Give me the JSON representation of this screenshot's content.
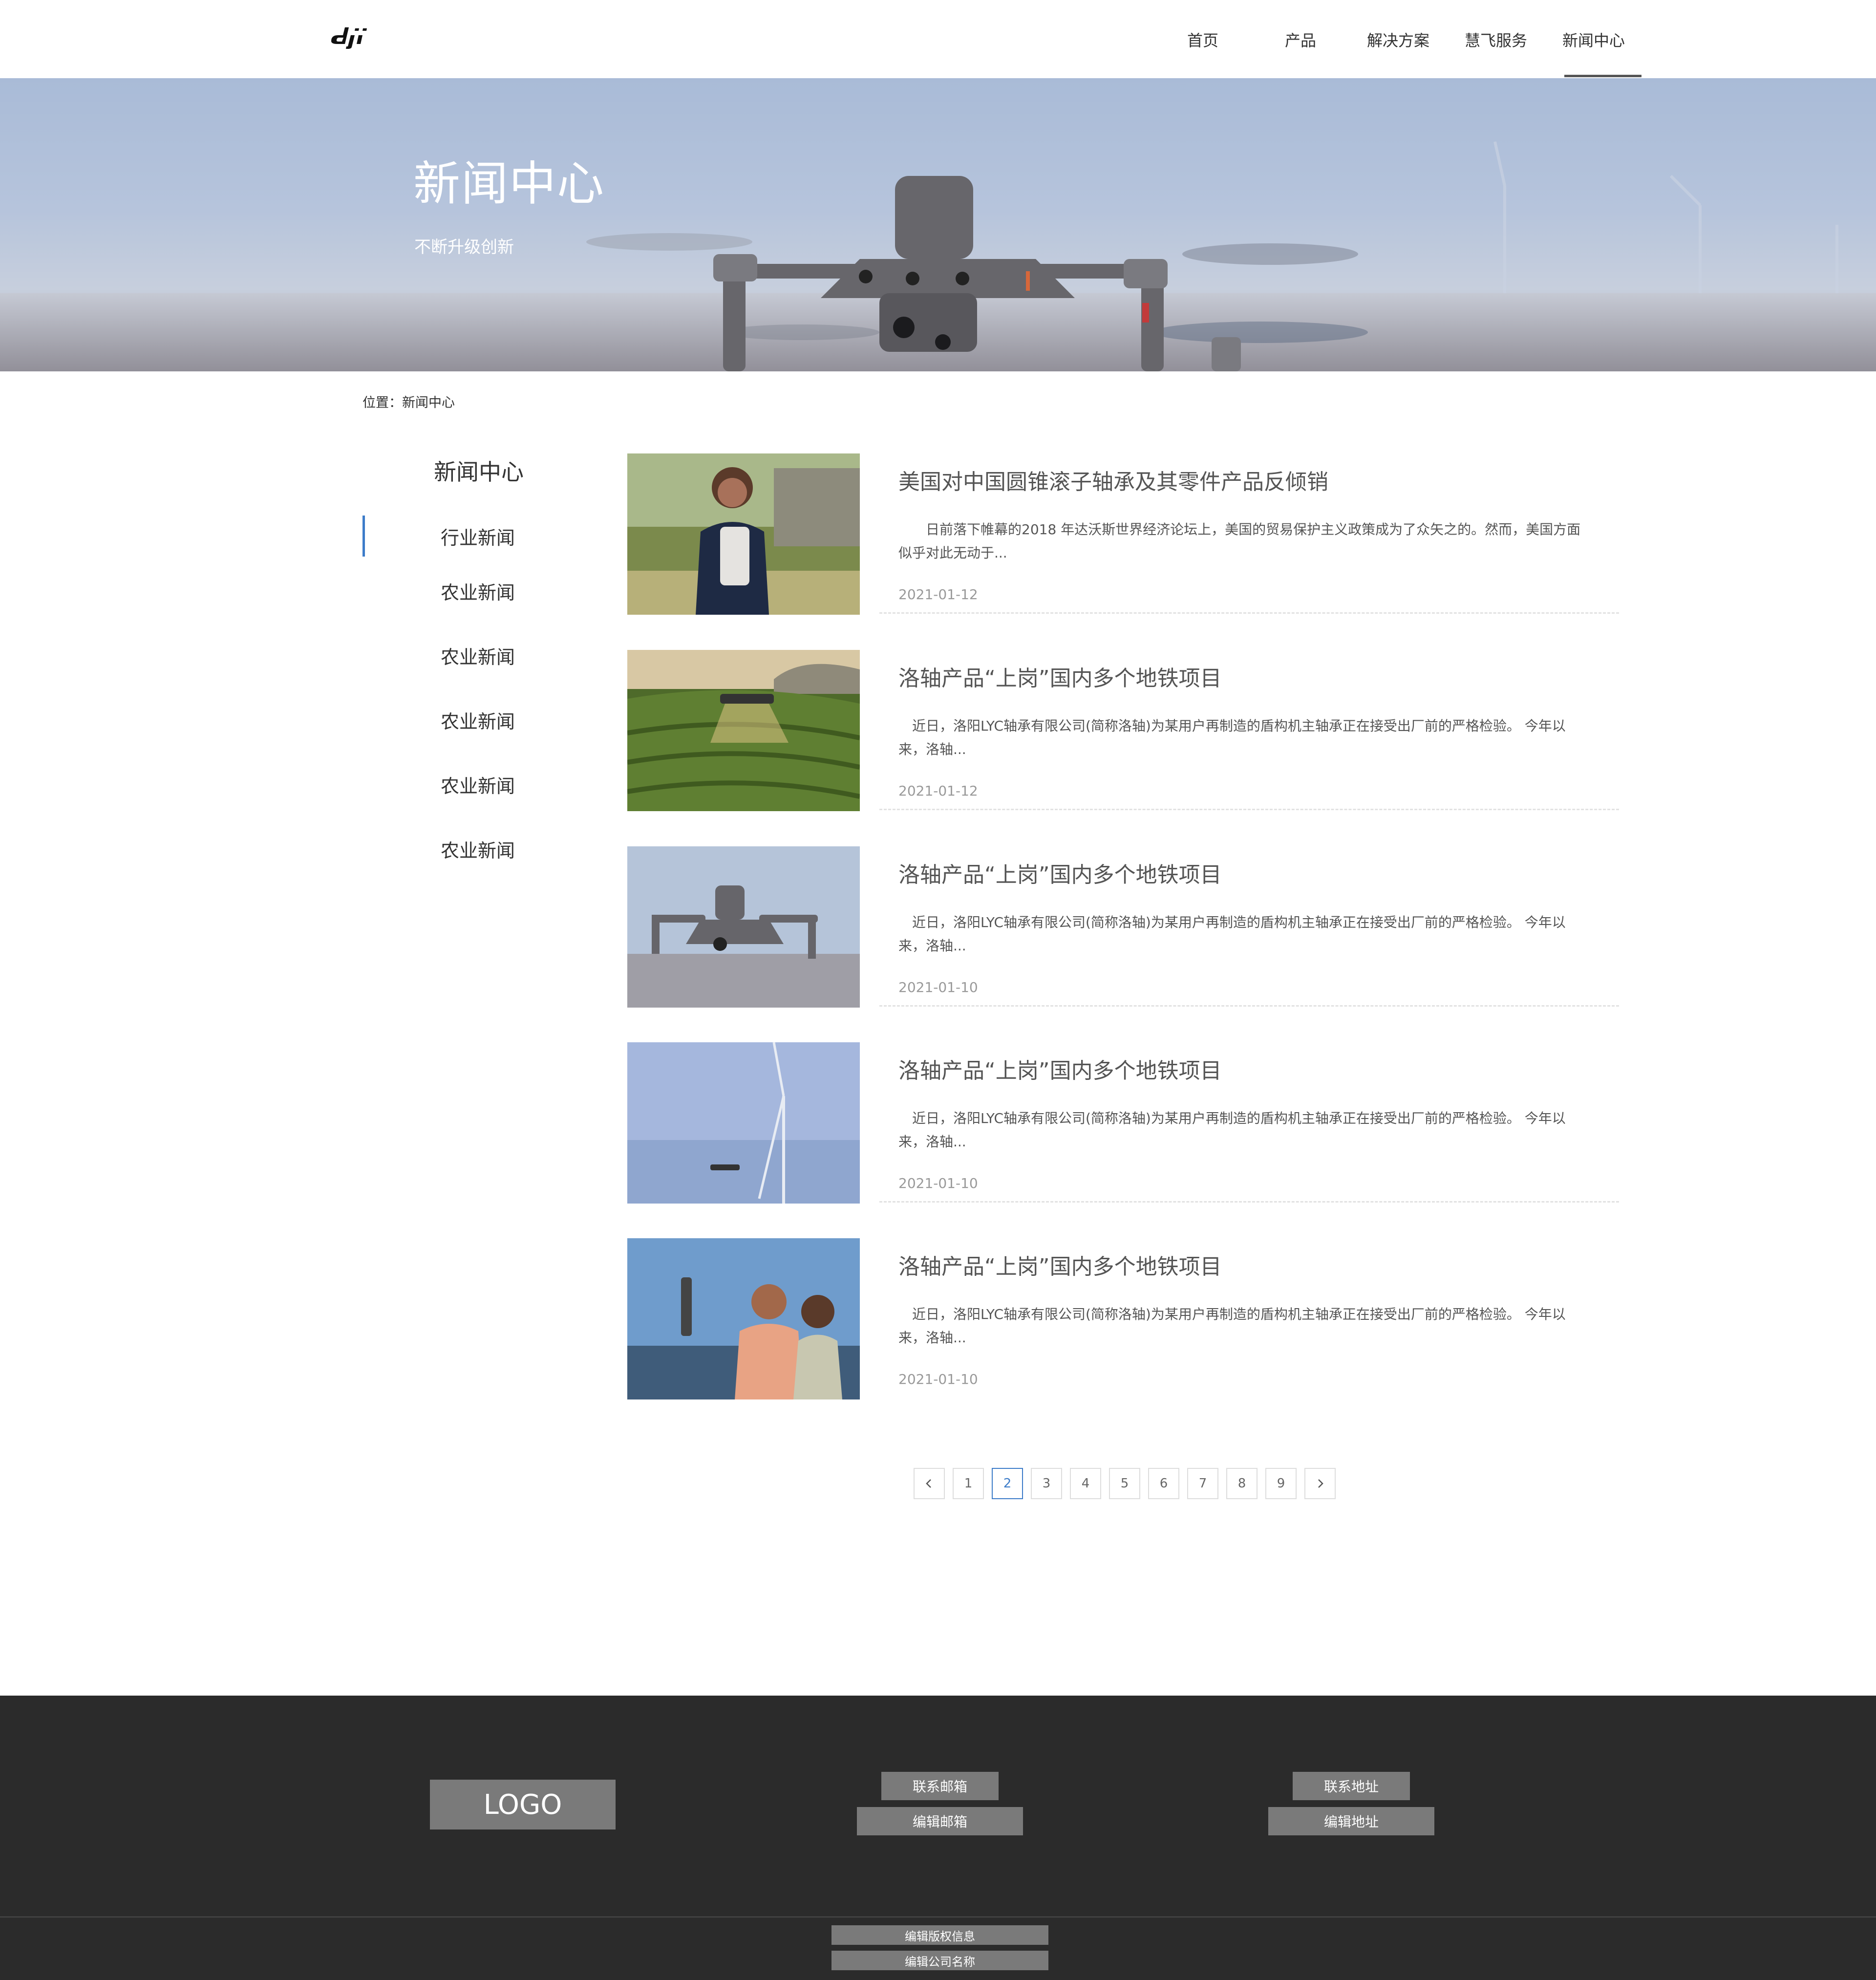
{
  "nav": {
    "items": [
      "首页",
      "产品",
      "解决方案",
      "慧飞服务",
      "新闻中心"
    ],
    "active_index": 4
  },
  "banner": {
    "title": "新闻中心",
    "subtitle": "不断升级创新"
  },
  "breadcrumb": "位置：新闻中心",
  "sidebar": {
    "title": "新闻中心",
    "items": [
      "行业新闻",
      "农业新闻",
      "农业新闻",
      "农业新闻",
      "农业新闻",
      "农业新闻"
    ],
    "active_index": 0
  },
  "news": [
    {
      "title": "美国对中国圆锥滚子轴承及其零件产品反倾销",
      "desc": "日前落下帷幕的2018 年达沃斯世界经济论坛上，美国的贸易保护主义政策成为了众矢之的。然而，美国方面似乎对此无动于...",
      "date": "2021-01-12",
      "image": "woman-with-gimbal-photo"
    },
    {
      "title": "洛轴产品“上岗”国内多个地铁项目",
      "desc": "近日，洛阳LYC轴承有限公司(简称洛轴)为某用户再制造的盾构机主轴承正在接受出厂前的严格检验。       今年以来，洛轴...",
      "date": "2021-01-12",
      "image": "agri-drone-spraying-photo"
    },
    {
      "title": "洛轴产品“上岗”国内多个地铁项目",
      "desc": "近日，洛阳LYC轴承有限公司(简称洛轴)为某用户再制造的盾构机主轴承正在接受出厂前的严格检验。       今年以来，洛轴...",
      "date": "2021-01-10",
      "image": "drone-on-gravel-photo"
    },
    {
      "title": "洛轴产品“上岗”国内多个地铁项目",
      "desc": "近日，洛阳LYC轴承有限公司(简称洛轴)为某用户再制造的盾构机主轴承正在接受出厂前的严格检验。       今年以来，洛轴...",
      "date": "2021-01-10",
      "image": "drone-wind-turbine-photo"
    },
    {
      "title": "洛轴产品“上岗”国内多个地铁项目",
      "desc": "近日，洛阳LYC轴承有限公司(简称洛轴)为某用户再制造的盾构机主轴承正在接受出厂前的严格检验。       今年以来，洛轴...",
      "date": "2021-01-10",
      "image": "couple-with-gimbal-photo"
    }
  ],
  "pagination": {
    "prev_icon": "chevron-left-icon",
    "next_icon": "chevron-right-icon",
    "pages": [
      "1",
      "2",
      "3",
      "4",
      "5",
      "6",
      "7",
      "8",
      "9"
    ],
    "current": "2"
  },
  "footer": {
    "logo": "LOGO",
    "email_label": "联系邮箱",
    "email_value": "编辑邮箱",
    "address_label": "联系地址",
    "address_value": "编辑地址",
    "copyright": "编辑版权信息",
    "company": "编辑公司名称"
  },
  "colors": {
    "accent": "#3d7cc9",
    "footer_bg": "#2b2b2b",
    "footer_box": "#7a7a7a"
  }
}
